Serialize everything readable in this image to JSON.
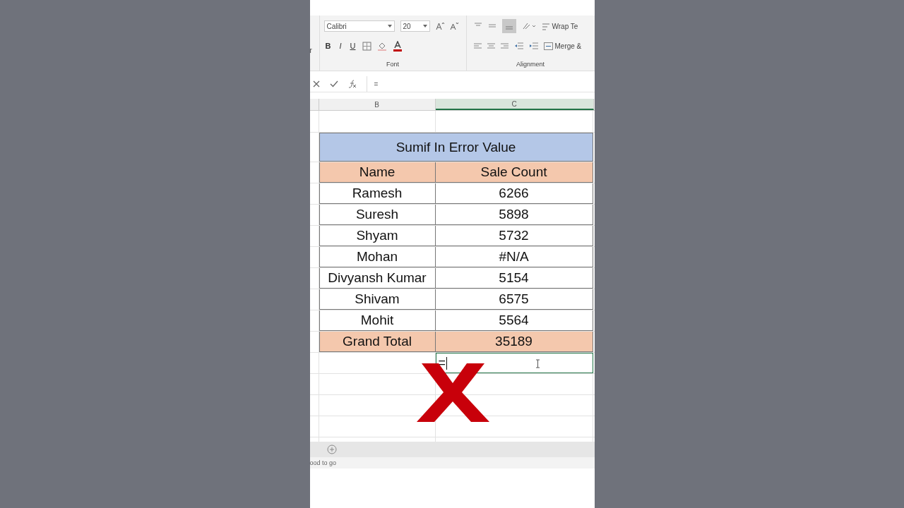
{
  "ribbon": {
    "cut_label": "r",
    "font_name": "Calibri",
    "font_size": "20",
    "format_buttons": [
      {
        "label": "B"
      },
      {
        "label": "I"
      },
      {
        "label": "U"
      }
    ],
    "wrap_text": "Wrap Te",
    "merge": "Merge &",
    "groups": [
      "Font",
      "Alignment"
    ]
  },
  "formula_bar": {
    "value": "="
  },
  "columns": [
    {
      "label": "B",
      "selected": false
    },
    {
      "label": "C",
      "selected": true
    }
  ],
  "table": {
    "title": "Sumif In Error Value",
    "headers": [
      "Name",
      "Sale Count"
    ],
    "rows": [
      [
        "Ramesh",
        "6266"
      ],
      [
        "Suresh",
        "5898"
      ],
      [
        "Shyam",
        "5732"
      ],
      [
        "Mohan",
        "#N/A"
      ],
      [
        "Divyansh Kumar",
        "5154"
      ],
      [
        "Shivam",
        "6575"
      ],
      [
        "Mohit",
        "5564"
      ]
    ],
    "total": [
      "Grand Total",
      "35189"
    ]
  },
  "edit_cell": {
    "value": "="
  },
  "status_bar": {
    "text": "ood to go"
  }
}
